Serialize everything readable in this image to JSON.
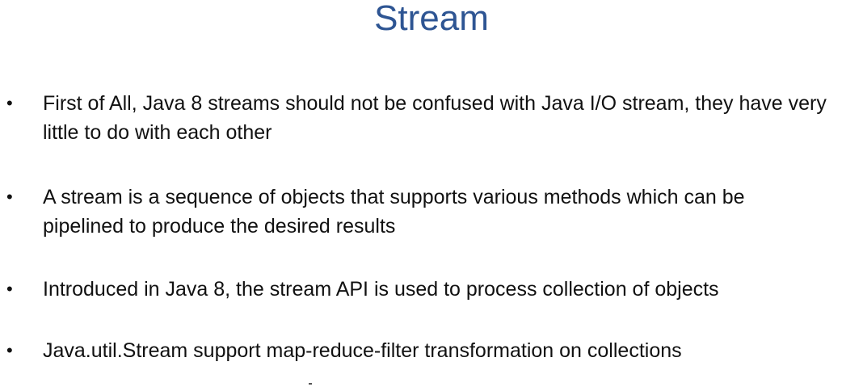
{
  "slide": {
    "title": "Stream",
    "bullets": [
      {
        "text": "First of All, Java 8 streams should not be confused with Java I/O stream, they have very little to do with each other"
      },
      {
        "text": "A stream is a sequence of objects that supports various methods which can be pipelined to produce the desired results"
      },
      {
        "text": "Introduced in Java 8, the stream API is used to process collection of objects"
      },
      {
        "text": "Java.util.Stream support map-reduce-filter transformation on collections"
      }
    ],
    "bullet_symbol": "•",
    "title_color": "#2e5593"
  }
}
